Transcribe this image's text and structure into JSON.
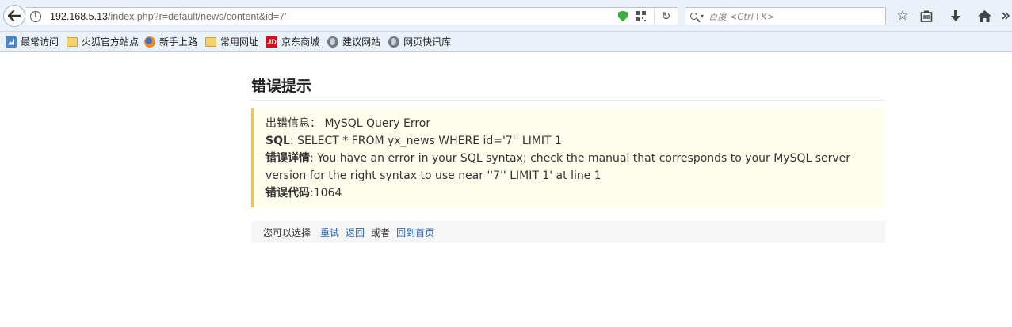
{
  "browser": {
    "url_host": "192.168.5.13",
    "url_path": "/index.php?r=default/news/content&id=7'",
    "search_placeholder": "百度 <Ctrl+K>"
  },
  "bookmarks": [
    {
      "label": "最常访问",
      "icon": "most-visited-icon"
    },
    {
      "label": "火狐官方站点",
      "icon": "folder-icon"
    },
    {
      "label": "新手上路",
      "icon": "firefox-icon"
    },
    {
      "label": "常用网址",
      "icon": "folder-icon"
    },
    {
      "label": "京东商城",
      "icon": "jd-icon",
      "icon_text": "JD"
    },
    {
      "label": "建议网站",
      "icon": "globe-icon"
    },
    {
      "label": "网页快讯库",
      "icon": "globe-icon"
    }
  ],
  "error": {
    "title": "错误提示",
    "info_label": "出错信息：",
    "info_value": "MySQL Query Error",
    "sql_label": "SQL",
    "sql_value": ": SELECT * FROM yx_news WHERE id='7'' LIMIT 1",
    "detail_label": "错误详情",
    "detail_value": ": You have an error in your SQL syntax; check the manual that corresponds to your MySQL server version for the right syntax to use near ''7'' LIMIT 1' at line 1",
    "code_label": "错误代码",
    "code_value": ":1064"
  },
  "actions": {
    "prompt": "您可以选择",
    "retry": "重试",
    "back": "返回",
    "or": "或者",
    "home": "回到首页"
  },
  "colors": {
    "accent_border": "#f5cc1e",
    "box_bg": "#fffdeb",
    "link": "#2a66b3"
  }
}
